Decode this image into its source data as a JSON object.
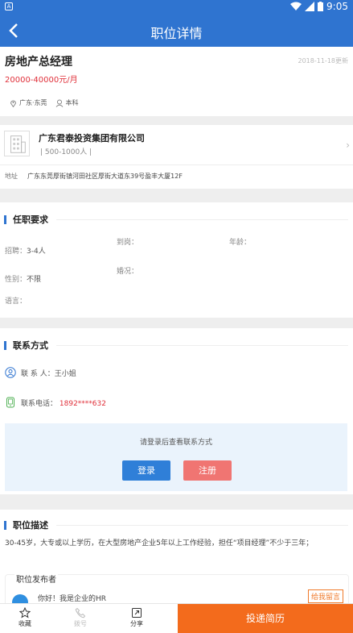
{
  "status_bar": {
    "time": "9:05",
    "left_badge": "A"
  },
  "header": {
    "title": "职位详情"
  },
  "job": {
    "title": "房地产总经理",
    "updated": "2018-11-18更新",
    "salary": "20000-40000元/月",
    "location": "广东·东莞",
    "education": "本科"
  },
  "company": {
    "name": "广东君泰投资集团有限公司",
    "size": "| 500-1000人 |",
    "address_label": "地址",
    "address": "广东东莞厚街镇河田社区厚街大道东39号盈丰大厦12F"
  },
  "requirements": {
    "title": "任职要求",
    "hire_label": "招聘：",
    "hire_value": "3-4人",
    "arrival_label": "到岗：",
    "age_label": "年龄：",
    "gender_label": "性别：",
    "gender_value": "不限",
    "marital_label": "婚况：",
    "language_label": "语言："
  },
  "contact": {
    "title": "联系方式",
    "person_label": "联 系 人：",
    "person_value": "王小姐",
    "phone_label": "联系电话：",
    "phone_value": "1892****632",
    "login_prompt": "请登录后查看联系方式",
    "login_button": "登录",
    "register_button": "注册"
  },
  "description": {
    "title": "职位描述",
    "text": "30-45岁，大专或以上学历，在大型房地产企业5年以上工作经验，担任“项目经理”不少于三年；",
    "publisher_title": "职位发布者",
    "publisher_message": "你好！我是企业的HR",
    "leave_message": "给我留言"
  },
  "bottom_bar": {
    "favorite": "收藏",
    "call": "拨号",
    "share": "分享",
    "apply": "投递简历"
  },
  "colors": {
    "primary": "#2f74d0",
    "salary": "#e0303a",
    "apply": "#f36b1c",
    "register": "#f07572"
  }
}
